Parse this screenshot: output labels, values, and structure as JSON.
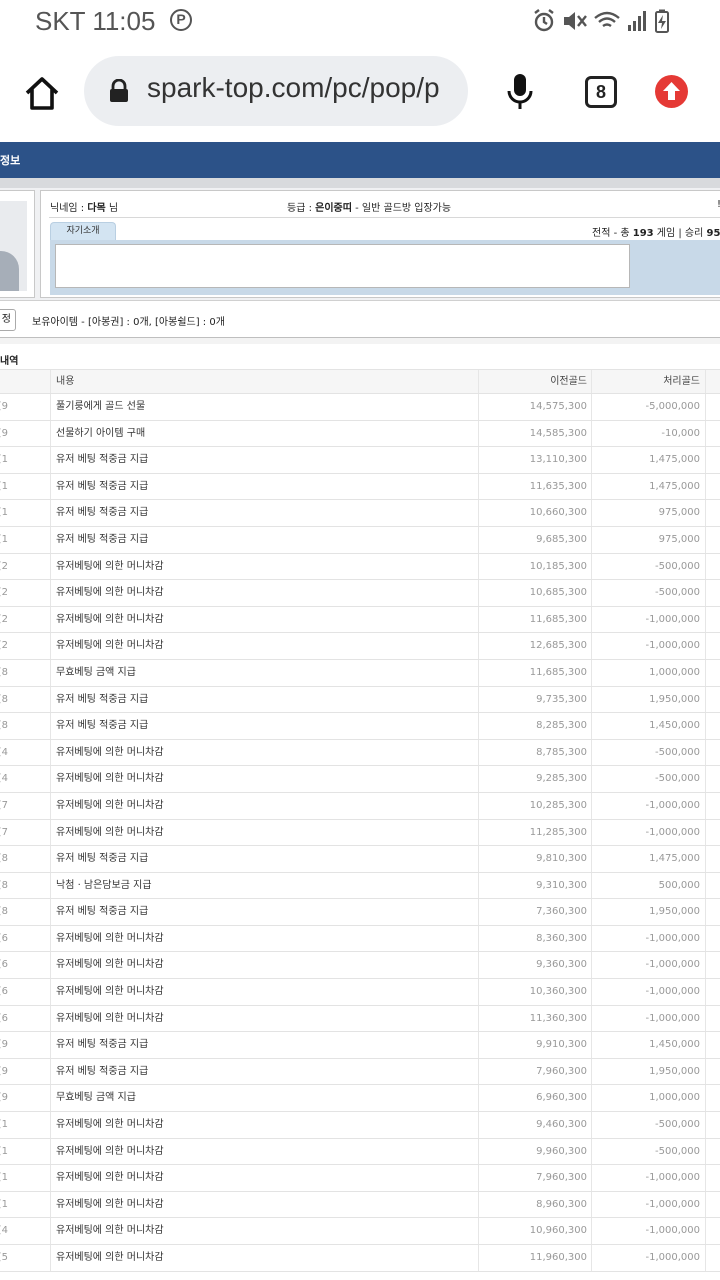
{
  "status_bar": {
    "carrier_time": "SKT 11:05",
    "p_badge": "P"
  },
  "browser": {
    "url": "spark-top.com/pc/pop/p",
    "tab_count": "8",
    "icons": [
      "home-icon",
      "lock-icon",
      "mic-icon",
      "tabs-icon",
      "update-arrow-icon"
    ]
  },
  "page": {
    "header_title": "정보",
    "profile": {
      "nickname_label": "닉네임 : ",
      "nickname": "다목",
      "nickname_suffix": " 님",
      "grade_label": "등급 : ",
      "grade": "은이중띠",
      "grade_note": " - 일반 골드방 입장가능",
      "far_right_mark": "!",
      "intro_tab": "자기소개",
      "record_label": "전적 - 총 ",
      "record_total": "193",
      "record_mid": " 게임 | 승리 ",
      "record_wins": "95",
      "intro_text": ""
    },
    "items": {
      "button_label": "정",
      "text": "보유아이템 - [아봉권] : 0개, [아봉쉴드] : 0개"
    },
    "history": {
      "section_title": "내역",
      "columns": {
        "content": "내용",
        "prev_gold": "이전골드",
        "proc_gold": "처리골드"
      },
      "rows": [
        {
          "date": "9]",
          "content": "풀기룽에게 골드 선물",
          "prev": "14,575,300",
          "proc": "-5,000,000"
        },
        {
          "date": "9]",
          "content": "선물하기 아이템 구매",
          "prev": "14,585,300",
          "proc": "-10,000"
        },
        {
          "date": "1]",
          "content": "유저 베팅 적중금 지급",
          "prev": "13,110,300",
          "proc": "1,475,000"
        },
        {
          "date": "1]",
          "content": "유저 베팅 적중금 지급",
          "prev": "11,635,300",
          "proc": "1,475,000"
        },
        {
          "date": "1]",
          "content": "유저 베팅 적중금 지급",
          "prev": "10,660,300",
          "proc": "975,000"
        },
        {
          "date": "1]",
          "content": "유저 베팅 적중금 지급",
          "prev": "9,685,300",
          "proc": "975,000"
        },
        {
          "date": "2]",
          "content": "유저베팅에 의한 머니차감",
          "prev": "10,185,300",
          "proc": "-500,000"
        },
        {
          "date": "2]",
          "content": "유저베팅에 의한 머니차감",
          "prev": "10,685,300",
          "proc": "-500,000"
        },
        {
          "date": "2]",
          "content": "유저베팅에 의한 머니차감",
          "prev": "11,685,300",
          "proc": "-1,000,000"
        },
        {
          "date": "2]",
          "content": "유저베팅에 의한 머니차감",
          "prev": "12,685,300",
          "proc": "-1,000,000"
        },
        {
          "date": "8]",
          "content": "무효베팅 금액 지급",
          "prev": "11,685,300",
          "proc": "1,000,000"
        },
        {
          "date": "8]",
          "content": "유저 베팅 적중금 지급",
          "prev": "9,735,300",
          "proc": "1,950,000"
        },
        {
          "date": "8]",
          "content": "유저 베팅 적중금 지급",
          "prev": "8,285,300",
          "proc": "1,450,000"
        },
        {
          "date": "4]",
          "content": "유저베팅에 의한 머니차감",
          "prev": "8,785,300",
          "proc": "-500,000"
        },
        {
          "date": "4]",
          "content": "유저베팅에 의한 머니차감",
          "prev": "9,285,300",
          "proc": "-500,000"
        },
        {
          "date": "7]",
          "content": "유저베팅에 의한 머니차감",
          "prev": "10,285,300",
          "proc": "-1,000,000"
        },
        {
          "date": "7]",
          "content": "유저베팅에 의한 머니차감",
          "prev": "11,285,300",
          "proc": "-1,000,000"
        },
        {
          "date": "8]",
          "content": "유저 베팅 적중금 지급",
          "prev": "9,810,300",
          "proc": "1,475,000"
        },
        {
          "date": "8]",
          "content": "낙첨 · 남은담보금 지급",
          "prev": "9,310,300",
          "proc": "500,000"
        },
        {
          "date": "8]",
          "content": "유저 베팅 적중금 지급",
          "prev": "7,360,300",
          "proc": "1,950,000"
        },
        {
          "date": "6]",
          "content": "유저베팅에 의한 머니차감",
          "prev": "8,360,300",
          "proc": "-1,000,000"
        },
        {
          "date": "6]",
          "content": "유저베팅에 의한 머니차감",
          "prev": "9,360,300",
          "proc": "-1,000,000"
        },
        {
          "date": "6]",
          "content": "유저베팅에 의한 머니차감",
          "prev": "10,360,300",
          "proc": "-1,000,000"
        },
        {
          "date": "6]",
          "content": "유저베팅에 의한 머니차감",
          "prev": "11,360,300",
          "proc": "-1,000,000"
        },
        {
          "date": "9]",
          "content": "유저 베팅 적중금 지급",
          "prev": "9,910,300",
          "proc": "1,450,000"
        },
        {
          "date": "9]",
          "content": "유저 베팅 적중금 지급",
          "prev": "7,960,300",
          "proc": "1,950,000"
        },
        {
          "date": "9]",
          "content": "무효베팅 금액 지급",
          "prev": "6,960,300",
          "proc": "1,000,000"
        },
        {
          "date": "1]",
          "content": "유저베팅에 의한 머니차감",
          "prev": "9,460,300",
          "proc": "-500,000"
        },
        {
          "date": "1]",
          "content": "유저베팅에 의한 머니차감",
          "prev": "9,960,300",
          "proc": "-500,000"
        },
        {
          "date": "1]",
          "content": "유저베팅에 의한 머니차감",
          "prev": "7,960,300",
          "proc": "-1,000,000"
        },
        {
          "date": "1]",
          "content": "유저베팅에 의한 머니차감",
          "prev": "8,960,300",
          "proc": "-1,000,000"
        },
        {
          "date": "4]",
          "content": "유저베팅에 의한 머니차감",
          "prev": "10,960,300",
          "proc": "-1,000,000"
        },
        {
          "date": "5]",
          "content": "유저베팅에 의한 머니차감",
          "prev": "11,960,300",
          "proc": "-1,000,000"
        }
      ]
    }
  },
  "colors": {
    "header_blue": "#2c5288",
    "update_red": "#e53935",
    "intro_blue": "#c8d9e8"
  }
}
